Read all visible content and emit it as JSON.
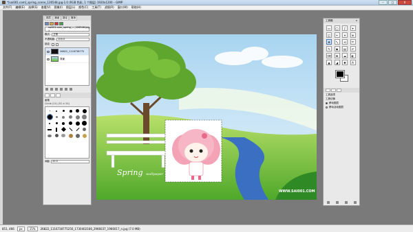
{
  "window": {
    "title": "*[sai001.com]_spring_scene_126548.jpg-1.0 (RGB 色彩, 1 个图层) 1920x1200 – GIMP",
    "min_label": "–",
    "max_label": "□",
    "close_label": "X"
  },
  "menu": [
    "文件(F)",
    "编辑(E)",
    "选择(S)",
    "查看(V)",
    "图像(I)",
    "图层(L)",
    "颜色(C)",
    "工具(T)",
    "滤镜(R)",
    "窗口(W)",
    "帮助(H)"
  ],
  "left_dock": {
    "tabs": [
      "图层",
      "通道",
      "路径",
      "撤销",
      "画笔",
      "图案",
      "渐变"
    ],
    "image_select": "sai001.com_spring_..._126548.jpg-1",
    "mode_label": "模式:",
    "mode_value": "正常",
    "opacity_label": "不透明度:",
    "opacity_value": "100.0",
    "lock_label": "锁定:",
    "layers": [
      {
        "name": "26822_1116738775",
        "selected": true
      },
      {
        "name": "背景",
        "selected": false
      }
    ],
    "brush_title": "画笔",
    "brush_name": "Circle (11) (51 × 51)",
    "spacing_label": "间距",
    "spacing_value": "20.0"
  },
  "toolbox": {
    "title": "工具箱",
    "close_label": "x",
    "tools": [
      "▭",
      "◯",
      "ʃ",
      "✦",
      "◫",
      "✂",
      "⌖",
      "⊕",
      "✥",
      "⤡",
      "⟲",
      "⤧",
      "✎",
      "◆",
      "▤",
      "✐",
      "⌫",
      "✿",
      "☁",
      "◐",
      "▲",
      "◢",
      "✺",
      "A"
    ],
    "options_title": "工具选项",
    "options": [
      "工具切换",
      "移动图层",
      "移动活动图层"
    ]
  },
  "canvas": {
    "spring_text": "Spring",
    "wallpaper_text": "wallpaper",
    "watermark": "WWW.SAI001.COM"
  },
  "status": {
    "coords": "851, 466",
    "unit": "px",
    "zoom": "15%",
    "message": "26822_1116738775250_1730402166_2966037_1966017_n.jpg (7.0 MB)"
  },
  "colors": {
    "sky": "#a8d4f0",
    "grass": "#6cc23a",
    "tree": "#5ea62e",
    "river": "#3b6fc2"
  }
}
